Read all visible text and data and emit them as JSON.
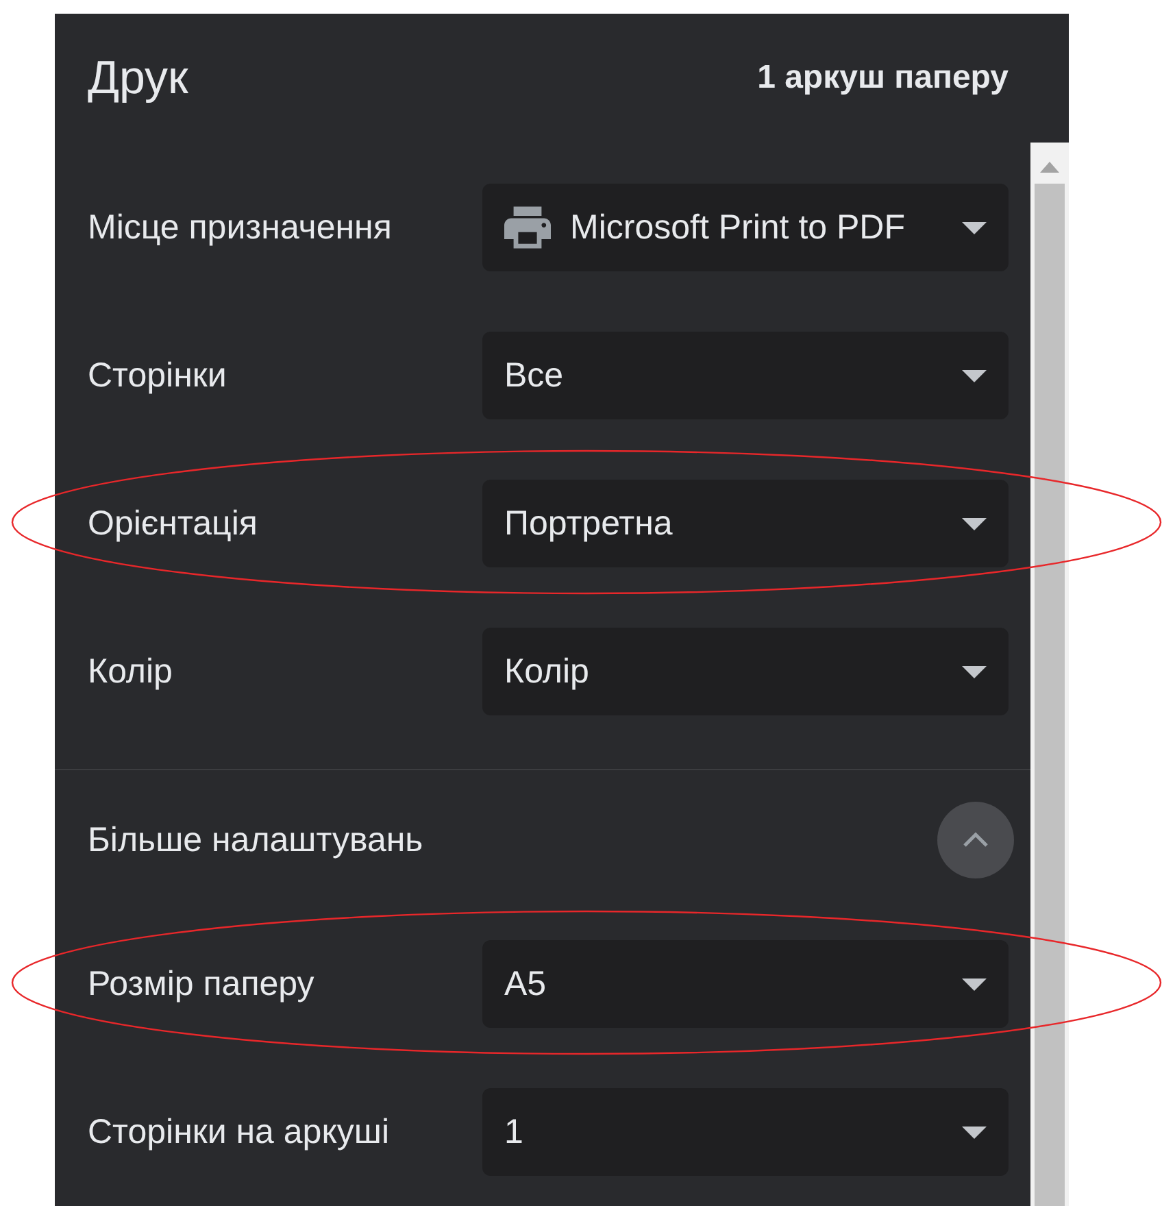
{
  "header": {
    "title": "Друк",
    "sheet_count": "1 аркуш паперу"
  },
  "settings": [
    {
      "kind": "printer",
      "label": "Місце призначення",
      "value": "Microsoft Print to PDF",
      "highlighted": false
    },
    {
      "kind": "plain",
      "label": "Сторінки",
      "value": "Все",
      "highlighted": false
    },
    {
      "kind": "plain",
      "label": "Орієнтація",
      "value": "Портретна",
      "highlighted": true
    },
    {
      "kind": "plain",
      "label": "Колір",
      "value": "Колір",
      "highlighted": false
    }
  ],
  "more_settings": {
    "label": "Більше налаштувань",
    "expanded": true
  },
  "extra_settings": [
    {
      "kind": "plain",
      "label": "Розмір паперу",
      "value": "A5",
      "highlighted": true
    },
    {
      "kind": "plain",
      "label": "Сторінки на аркуші",
      "value": "1",
      "highlighted": false
    }
  ]
}
